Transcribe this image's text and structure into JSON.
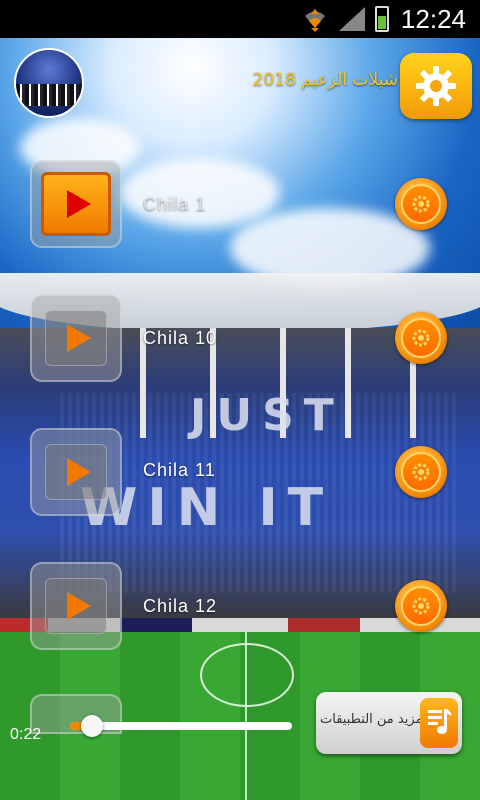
{
  "status_bar": {
    "time": "12:24"
  },
  "header": {
    "title": "شيلات الزعيم 2018"
  },
  "tracks": [
    {
      "label": "Chila  1",
      "active": true
    },
    {
      "label": "Chila  10",
      "active": false
    },
    {
      "label": "Chila  11",
      "active": false
    },
    {
      "label": "Chila  12",
      "active": false
    }
  ],
  "background": {
    "tifo_line1": "JUST",
    "tifo_line2": "WIN IT"
  },
  "player": {
    "elapsed": "0:22",
    "progress": 0.1
  },
  "more_apps": {
    "label": "مزيد من التطبيقات"
  },
  "colors": {
    "accent": "#f08a00",
    "title": "#f5c518"
  }
}
